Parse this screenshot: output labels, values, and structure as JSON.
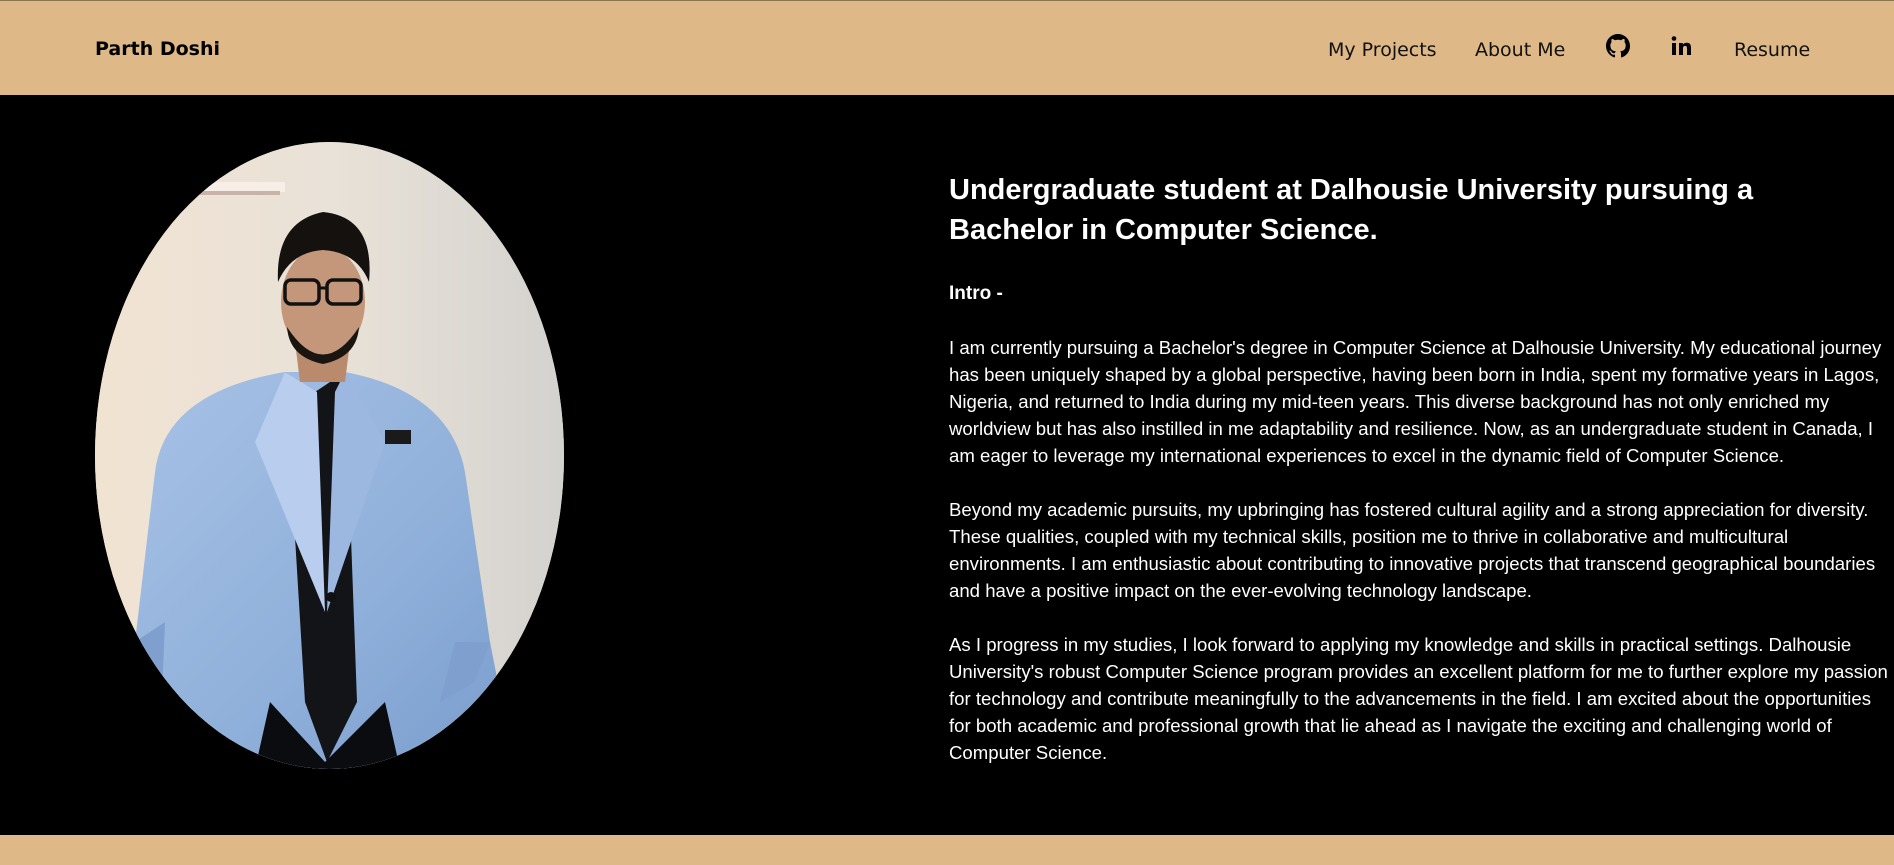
{
  "navbar": {
    "brand": "Parth Doshi",
    "links": {
      "projects": "My Projects",
      "about": "About Me",
      "resume": "Resume"
    },
    "icons": [
      "github-icon",
      "linkedin-icon"
    ],
    "background": "#DEB887"
  },
  "hero": {
    "headline": "Undergraduate student at Dalhousie University pursuing a Bachelor in Computer Science.",
    "intro_label": "Intro -",
    "paragraphs": [
      "I am currently pursuing a Bachelor's degree in Computer Science at Dalhousie University. My educational journey has been uniquely shaped by a global perspective, having been born in India, spent my formative years in Lagos, Nigeria, and returned to India during my mid-teen years. This diverse background has not only enriched my worldview but has also instilled in me adaptability and resilience. Now, as an undergraduate student in Canada, I am eager to leverage my international experiences to excel in the dynamic field of Computer Science.",
      "Beyond my academic pursuits, my upbringing has fostered cultural agility and a strong appreciation for diversity. These qualities, coupled with my technical skills, position me to thrive in collaborative and multicultural environments. I am enthusiastic about contributing to innovative projects that transcend geographical boundaries and have a positive impact on the ever-evolving technology landscape.",
      "As I progress in my studies, I look forward to applying my knowledge and skills in practical settings. Dalhousie University's robust Computer Science program provides an excellent platform for me to further explore my passion for technology and contribute meaningfully to the advancements in the field. I am excited about the opportunities for both academic and professional growth that lie ahead as I navigate the exciting and challenging world of Computer Science."
    ]
  },
  "colors": {
    "accent": "#DEB887",
    "background": "#000000",
    "text": "#FFFFFF"
  }
}
